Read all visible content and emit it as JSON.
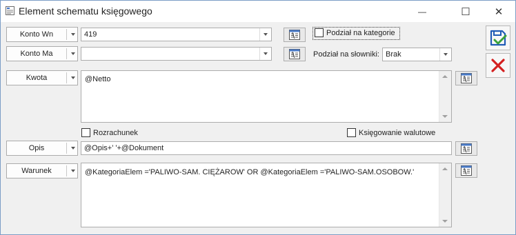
{
  "window": {
    "title": "Element schematu księgowego",
    "minimize_glyph": "—",
    "restore_glyph": "☐",
    "close_glyph": "✕"
  },
  "konto_wn": {
    "label": "Konto Wn",
    "value": "419"
  },
  "konto_ma": {
    "label": "Konto Ma",
    "value": ""
  },
  "podzial_na_kategorie": {
    "label": "Podział na kategorie",
    "checked": false
  },
  "podzial_na_slowniki": {
    "label": "Podział na słowniki:",
    "value": "Brak"
  },
  "kwota": {
    "label": "Kwota",
    "value": "@Netto"
  },
  "rozrachunek": {
    "label": "Rozrachunek",
    "checked": false
  },
  "ksiegowanie_walutowe": {
    "label": "Księgowanie walutowe",
    "checked": false
  },
  "opis": {
    "label": "Opis",
    "value": "@Opis+' '+@Dokument"
  },
  "warunek": {
    "label": "Warunek",
    "value": "@KategoriaElem ='PALIWO-SAM. CIĘŻAROW' OR @KategoriaElem ='PALIWO-SAM.OSOBOW.'"
  },
  "icons": {
    "save": "save-close-icon",
    "cancel": "cancel-icon",
    "formula": "formula-editor-icon",
    "dropdown": "chevron-down-icon"
  },
  "colors": {
    "save_accent": "#1f5bb6",
    "save_check": "#3aa23a",
    "cancel_red": "#d42020"
  }
}
